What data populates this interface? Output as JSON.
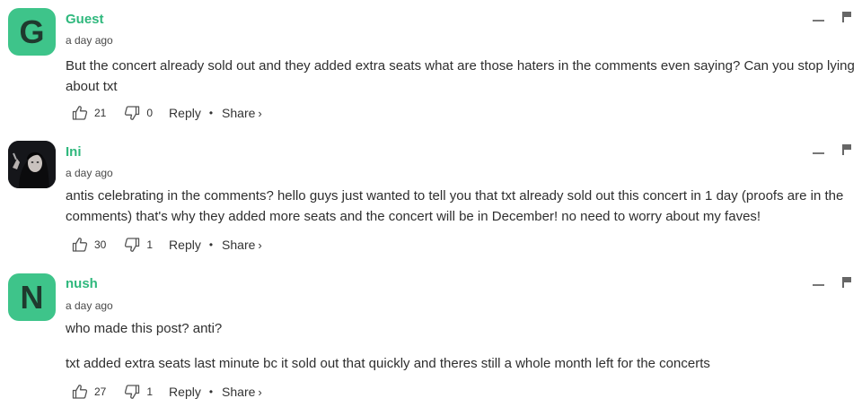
{
  "comments": [
    {
      "avatar_letter": "G",
      "avatar_color": "#3ec48a",
      "username": "Guest",
      "time": "a day ago",
      "paragraphs": [
        "But the concert already sold out and they added extra seats what are those haters in the comments even saying? Can you stop lying about txt"
      ],
      "likes": "21",
      "dislikes": "0",
      "reply_label": "Reply",
      "share_label": "Share"
    },
    {
      "avatar_letter": "",
      "avatar_color": "#16171b",
      "username": "Ini",
      "time": "a day ago",
      "paragraphs": [
        "antis celebrating in the comments? hello guys just wanted to tell you that txt already sold out this concert in 1 day (proofs are in the comments) that's why they added more seats and the concert will be in December! no need to worry about my faves!"
      ],
      "likes": "30",
      "dislikes": "1",
      "reply_label": "Reply",
      "share_label": "Share"
    },
    {
      "avatar_letter": "N",
      "avatar_color": "#3ec48a",
      "username": "nush",
      "time": "a day ago",
      "paragraphs": [
        "who made this post? anti?",
        "txt added extra seats last minute bc it sold out that quickly and theres still a whole month left for the concerts"
      ],
      "likes": "27",
      "dislikes": "1",
      "reply_label": "Reply",
      "share_label": "Share"
    }
  ],
  "colors": {
    "username": "#2fb87d",
    "avatar_bg": "#3ec48a",
    "text": "#2e2e2e"
  },
  "icons": {
    "like": "thumbs-up-icon",
    "dislike": "thumbs-down-icon",
    "minimize": "minimize-icon",
    "flag": "flag-icon",
    "share": "chevron-right-icon"
  }
}
